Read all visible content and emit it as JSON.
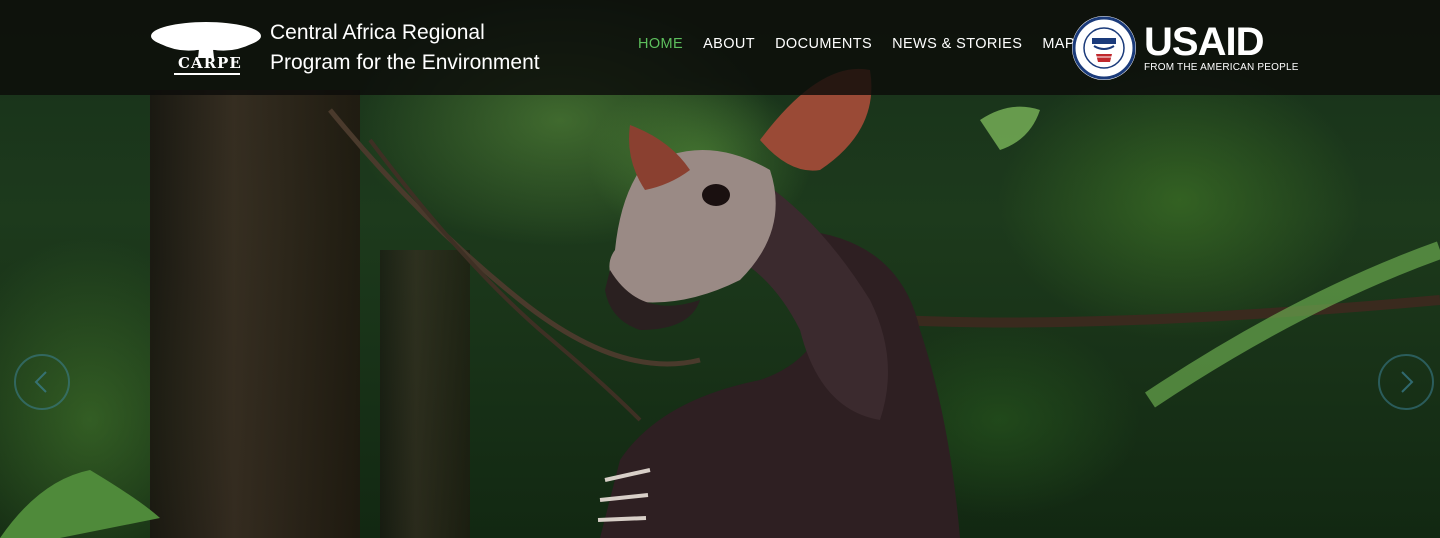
{
  "header": {
    "logo_text": "CARPE",
    "title_line1": "Central Africa Regional",
    "title_line2": "Program for the Environment"
  },
  "nav": {
    "items": [
      {
        "label": "HOME",
        "active": true
      },
      {
        "label": "ABOUT"
      },
      {
        "label": "DOCUMENTS"
      },
      {
        "label": "NEWS & STORIES"
      },
      {
        "label": "MAPS"
      }
    ]
  },
  "partner": {
    "name": "USAID",
    "tagline": "FROM THE AMERICAN PEOPLE",
    "seal_text": "USAID"
  },
  "slider": {
    "prev_icon": "chevron-left-icon",
    "next_icon": "chevron-right-icon"
  },
  "colors": {
    "active_nav": "#5dbf5d",
    "header_bg": "#0c0c0a"
  }
}
